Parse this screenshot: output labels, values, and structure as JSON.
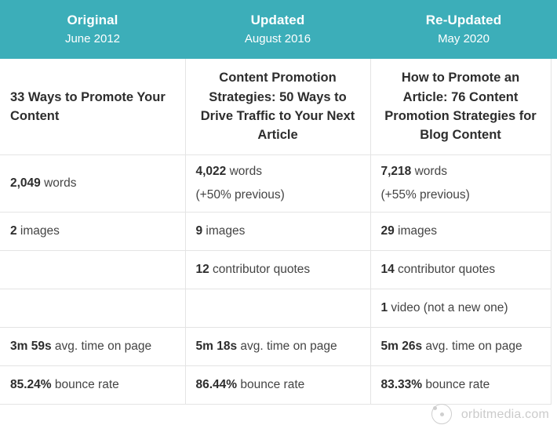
{
  "header": {
    "columns": [
      {
        "title": "Original",
        "subtitle": "June 2012"
      },
      {
        "title": "Updated",
        "subtitle": "August 2016"
      },
      {
        "title": "Re-Updated",
        "subtitle": "May 2020"
      }
    ],
    "background_color": "#3caeb9",
    "text_color": "#ffffff"
  },
  "table": {
    "article_titles": [
      "33 Ways to Promote Your Content",
      "Content Promotion Strategies: 50 Ways to Drive Traffic to Your Next Article",
      "How to Promote an Article: 76 Content Promotion Strategies for Blog Content"
    ],
    "rows": [
      {
        "name": "word-count",
        "cells": [
          {
            "value": "2,049",
            "label": " words",
            "note": ""
          },
          {
            "value": "4,022",
            "label": " words",
            "note": "(+50% previous)"
          },
          {
            "value": "7,218",
            "label": " words",
            "note": "(+55% previous)"
          }
        ]
      },
      {
        "name": "image-count",
        "cells": [
          {
            "value": "2",
            "label": " images",
            "note": ""
          },
          {
            "value": "9",
            "label": " images",
            "note": ""
          },
          {
            "value": "29",
            "label": " images",
            "note": ""
          }
        ]
      },
      {
        "name": "contributor-quotes",
        "cells": [
          {
            "value": "",
            "label": "",
            "note": ""
          },
          {
            "value": "12",
            "label": " contributor quotes",
            "note": ""
          },
          {
            "value": "14",
            "label": " contributor quotes",
            "note": ""
          }
        ]
      },
      {
        "name": "video-count",
        "cells": [
          {
            "value": "",
            "label": "",
            "note": ""
          },
          {
            "value": "",
            "label": "",
            "note": ""
          },
          {
            "value": "1",
            "label": " video (not a new one)",
            "note": ""
          }
        ]
      },
      {
        "name": "avg-time-on-page",
        "cells": [
          {
            "value": "3m 59s",
            "label": " avg. time on page",
            "note": ""
          },
          {
            "value": "5m 18s",
            "label": " avg. time on page",
            "note": ""
          },
          {
            "value": "5m 26s",
            "label": " avg. time on page",
            "note": ""
          }
        ]
      },
      {
        "name": "bounce-rate",
        "cells": [
          {
            "value": "85.24%",
            "label": " bounce rate",
            "note": ""
          },
          {
            "value": "86.44%",
            "label": " bounce rate",
            "note": ""
          },
          {
            "value": "83.33%",
            "label": " bounce rate",
            "note": ""
          }
        ]
      }
    ]
  },
  "footer": {
    "brand": "orbitmedia.com",
    "logo_icon": "orbit-icon",
    "color": "#cbcbcb"
  }
}
